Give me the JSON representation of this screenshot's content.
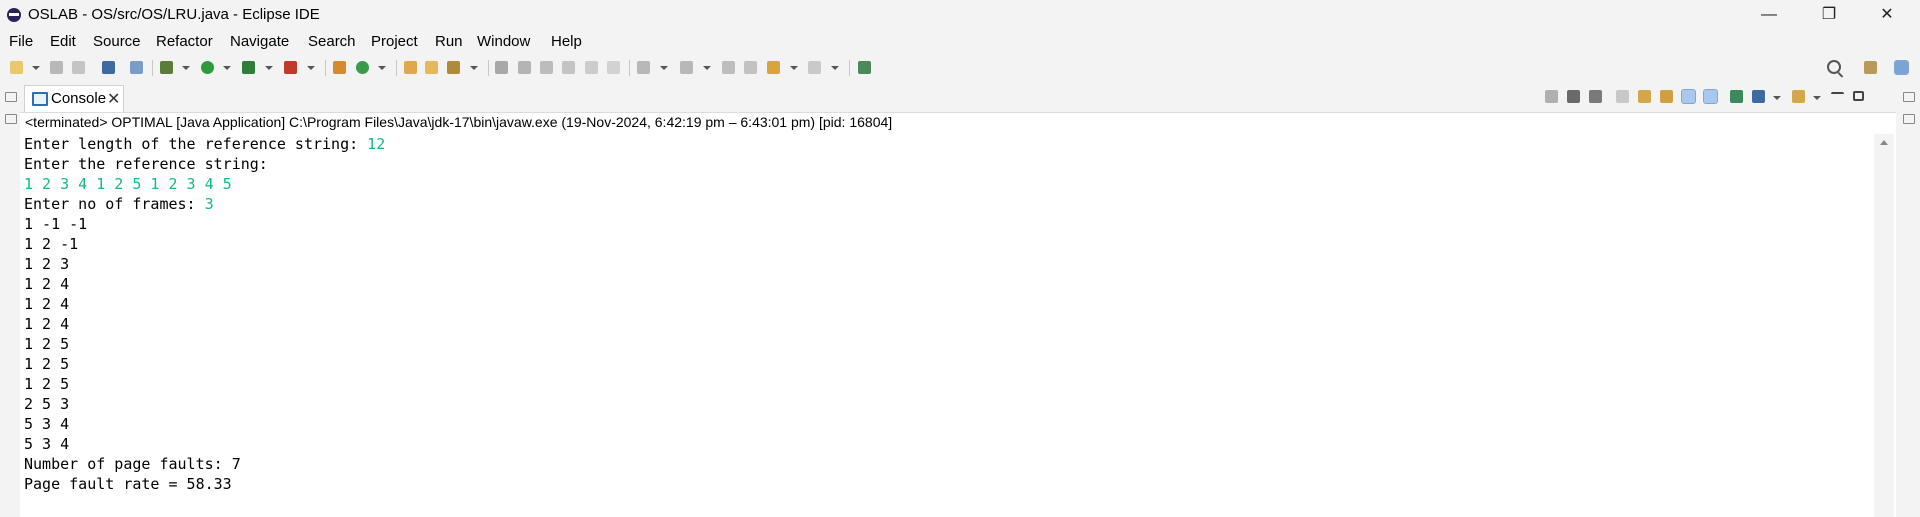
{
  "window": {
    "title": "OSLAB - OS/src/OS/LRU.java - Eclipse IDE",
    "minimize": "—",
    "restore": "❐",
    "close": "✕"
  },
  "menubar": {
    "items": [
      "File",
      "Edit",
      "Source",
      "Refactor",
      "Navigate",
      "Search",
      "Project",
      "Run",
      "Window",
      "Help"
    ]
  },
  "view": {
    "tab_label": "Console",
    "tab_close": "✕",
    "status": "<terminated> OPTIMAL [Java Application] C:\\Program Files\\Java\\jdk-17\\bin\\javaw.exe  (19-Nov-2024, 6:42:19 pm – 6:43:01 pm) [pid: 16804]"
  },
  "console": {
    "line1_prompt": "Enter length of the reference string: ",
    "line1_input": "12",
    "line2_prompt": "Enter the reference string:",
    "line3_input": "1 2 3 4 1 2 5 1 2 3 4 5",
    "line4_prompt": "Enter no of frames: ",
    "line4_input": "3",
    "frames": [
      "1 -1 -1",
      "1 2 -1",
      "1 2 3",
      "1 2 4",
      "1 2 4",
      "1 2 4",
      "1 2 5",
      "1 2 5",
      "1 2 5",
      "2 5 3",
      "5 3 4",
      "5 3 4"
    ],
    "faults_line": "Number of page faults: 7",
    "rate_line": "Page fault rate = 58.33"
  },
  "colors": {
    "input_text": "#16b88a",
    "chrome_bg": "#f3f3f3"
  }
}
